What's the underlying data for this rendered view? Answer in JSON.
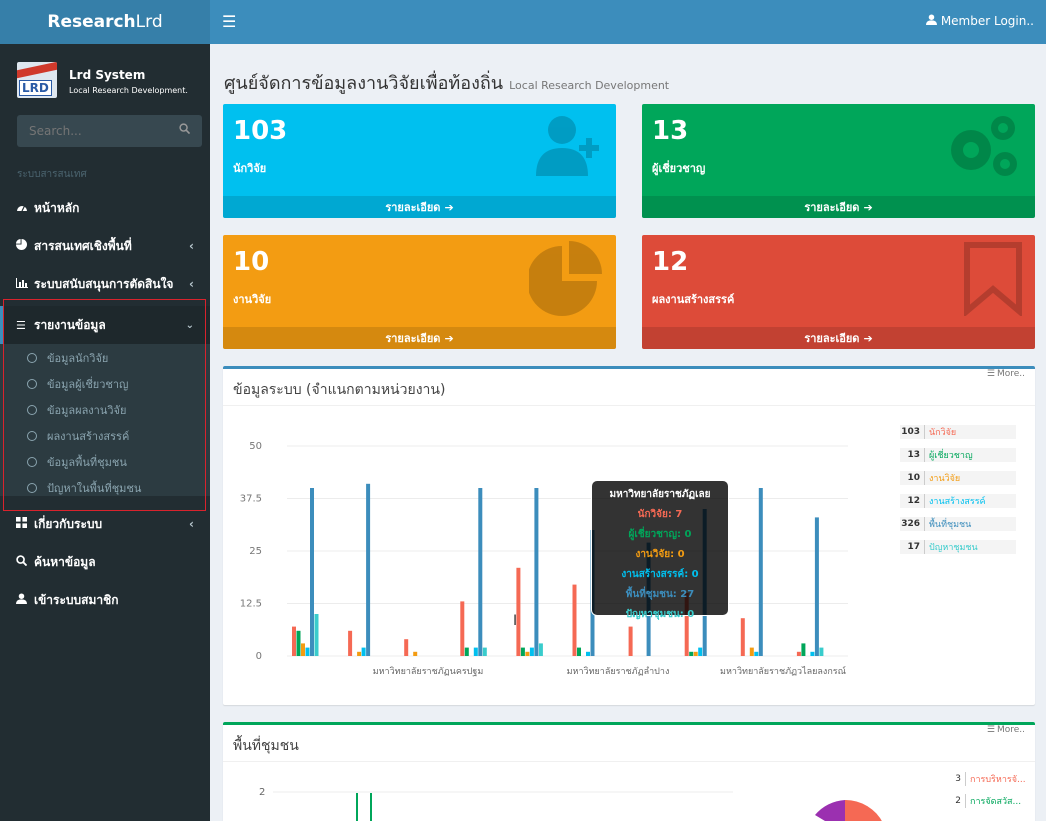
{
  "header": {
    "logo_bold": "Research",
    "logo_rest": "Lrd",
    "member_login": "Member Login.."
  },
  "sidebar": {
    "brand_name": "Lrd System",
    "brand_sub": "Local Research Development.",
    "logo_text": "LRD",
    "search_placeholder": "Search...",
    "section_header": "ระบบสารสนเทศ",
    "items": [
      {
        "label": "หน้าหลัก",
        "icon": "dashboard-icon"
      },
      {
        "label": "สารสนเทศเชิงพื้นที่",
        "icon": "pie-chart-icon"
      },
      {
        "label": "ระบบสนับสนุนการตัดสินใจ",
        "icon": "bar-chart-icon"
      },
      {
        "label": "รายงานข้อมูล",
        "icon": "list-icon"
      },
      {
        "label": "เกี่ยวกับระบบ",
        "icon": "grid-icon"
      },
      {
        "label": "ค้นหาข้อมูล",
        "icon": "search-icon"
      },
      {
        "label": "เข้าระบบสมาชิก",
        "icon": "user-icon"
      }
    ],
    "submenu": [
      "ข้อมูลนักวิจัย",
      "ข้อมูลผู้เชี่ยวชาญ",
      "ข้อมูลผลงานวิจัย",
      "ผลงานสร้างสรรค์",
      "ข้อมูลพื้นที่ชุมชน",
      "ปัญหาในพื้นที่ชุมชน"
    ]
  },
  "page": {
    "title": "ศูนย์จัดการข้อมูลงานวิจัยเพื่อท้องถิ่น",
    "subtitle": "Local Research Development"
  },
  "stats": [
    {
      "value": "103",
      "label": "นักวิจัย",
      "footer": "รายละเอียด",
      "color": "#00c0ef"
    },
    {
      "value": "13",
      "label": "ผู้เชี่ยวชาญ",
      "footer": "รายละเอียด",
      "color": "#00a65a"
    },
    {
      "value": "10",
      "label": "งานวิจัย",
      "footer": "รายละเอียด",
      "color": "#f39c12"
    },
    {
      "value": "12",
      "label": "ผลงานสร้างสรรค์",
      "footer": "รายละเอียด",
      "color": "#dd4b39"
    }
  ],
  "panel1": {
    "title": "ข้อมูลระบบ (จำแนกตามหน่วยงาน)",
    "more": "More..",
    "legend": [
      {
        "count": "103",
        "name": "นักวิจัย",
        "color": "#f56954"
      },
      {
        "count": "13",
        "name": "ผู้เชี่ยวชาญ",
        "color": "#00a65a"
      },
      {
        "count": "10",
        "name": "งานวิจัย",
        "color": "#f39c12"
      },
      {
        "count": "12",
        "name": "งานสร้างสรรค์",
        "color": "#00c0ef"
      },
      {
        "count": "326",
        "name": "พื้นที่ชุมชน",
        "color": "#3c8dbc"
      },
      {
        "count": "17",
        "name": "ปัญหาชุมชน",
        "color": "#39cccc"
      }
    ],
    "tooltip": {
      "title": "มหาวิทยาลัยราชภัฏเลย",
      "lines": [
        "นักวิจัย: 7",
        "ผู้เชี่ยวชาญ: 0",
        "งานวิจัย: 0",
        "งานสร้างสรรค์: 0",
        "พื้นที่ชุมชน: 27",
        "ปัญหาชุมชน: 0"
      ]
    }
  },
  "chart_data": [
    {
      "type": "bar",
      "ylim": [
        0,
        50
      ],
      "yticks": [
        "0",
        "12.5",
        "25",
        "37.5",
        "50"
      ],
      "x_tick_labels": [
        "มหาวิทยาลัยราชภัฏนครปฐม",
        "มหาวิทยาลัยราชภัฏลำปาง",
        "มหาวิทยาลัยราชภัฏวไลยลงกรณ์"
      ],
      "series_colors": [
        "#f56954",
        "#00a65a",
        "#f39c12",
        "#00c0ef",
        "#3c8dbc",
        "#39cccc"
      ],
      "groups": [
        [
          7,
          6,
          3,
          2,
          40,
          10
        ],
        [
          6,
          0,
          1,
          2,
          41,
          0
        ],
        [
          4,
          0,
          1,
          0,
          0,
          0
        ],
        [
          13,
          2,
          0,
          2,
          40,
          2
        ],
        [
          21,
          2,
          1,
          2,
          40,
          3
        ],
        [
          17,
          2,
          0,
          1,
          30,
          0
        ],
        [
          7,
          0,
          0,
          0,
          27,
          0
        ],
        [
          15,
          1,
          1,
          2,
          35,
          0
        ],
        [
          9,
          0,
          2,
          1,
          40,
          0
        ],
        [
          1,
          3,
          0,
          1,
          33,
          2
        ]
      ]
    },
    {
      "type": "bar",
      "ylim": [
        0,
        2
      ],
      "yticks": [
        "2"
      ]
    }
  ],
  "panel2": {
    "title": "พื้นที่ชุมชน",
    "more": "More..",
    "legend": [
      {
        "count": "3",
        "name": "การบริหารจั...",
        "color": "#f56954"
      },
      {
        "count": "2",
        "name": "การจัดสวัส...",
        "color": "#00a65a"
      }
    ]
  }
}
